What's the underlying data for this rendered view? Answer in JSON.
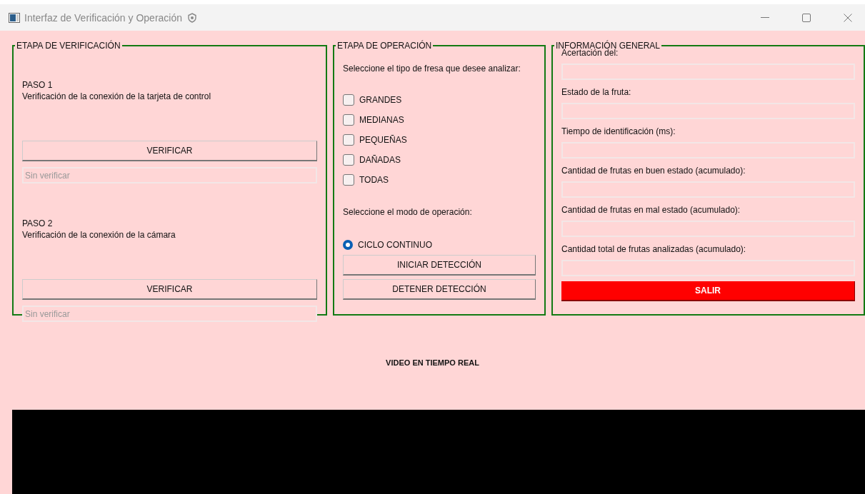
{
  "window": {
    "title": "Interfaz de Verificación y Operación"
  },
  "verification": {
    "title": "ETAPA DE VERIFICACIÓN",
    "steps": [
      {
        "label": "PASO 1",
        "description": "Verificación de la conexión de la tarjeta de control",
        "button": "VERIFICAR",
        "placeholder": "Sin verificar"
      },
      {
        "label": "PASO 2",
        "description": "Verificación de la conexión de la cámara",
        "button": "VERIFICAR",
        "placeholder": "Sin verificar"
      }
    ]
  },
  "operation": {
    "title": "ETAPA DE OPERACIÓN",
    "type_prompt": "Seleccione el tipo de fresa que desee analizar:",
    "types": [
      {
        "label": "GRANDES",
        "checked": false
      },
      {
        "label": "MEDIANAS",
        "checked": false
      },
      {
        "label": "PEQUEÑAS",
        "checked": false
      },
      {
        "label": "DAÑADAS",
        "checked": false
      },
      {
        "label": "TODAS",
        "checked": false
      }
    ],
    "mode_prompt": "Seleccione el modo de operación:",
    "modes": [
      {
        "label": "CICLO CONTINUO",
        "selected": true
      }
    ],
    "buttons": [
      "INICIAR DETECCIÓN",
      "DETENER DETECCIÓN"
    ]
  },
  "info": {
    "title": "INFORMACIÓN GENERAL",
    "fields": [
      {
        "label": "Acertación del:"
      },
      {
        "label": "Estado de la fruta:"
      },
      {
        "label": "Tiempo de identificación (ms):"
      },
      {
        "label": "Cantidad de frutas en buen estado (acumulado):"
      },
      {
        "label": "Cantidad de frutas en mal estado (acumulado):"
      },
      {
        "label": "Cantidad total de frutas analizadas (acumulado):"
      }
    ],
    "exit_button": "SALIR"
  },
  "video": {
    "label": "VIDEO EN TIEMPO REAL"
  }
}
